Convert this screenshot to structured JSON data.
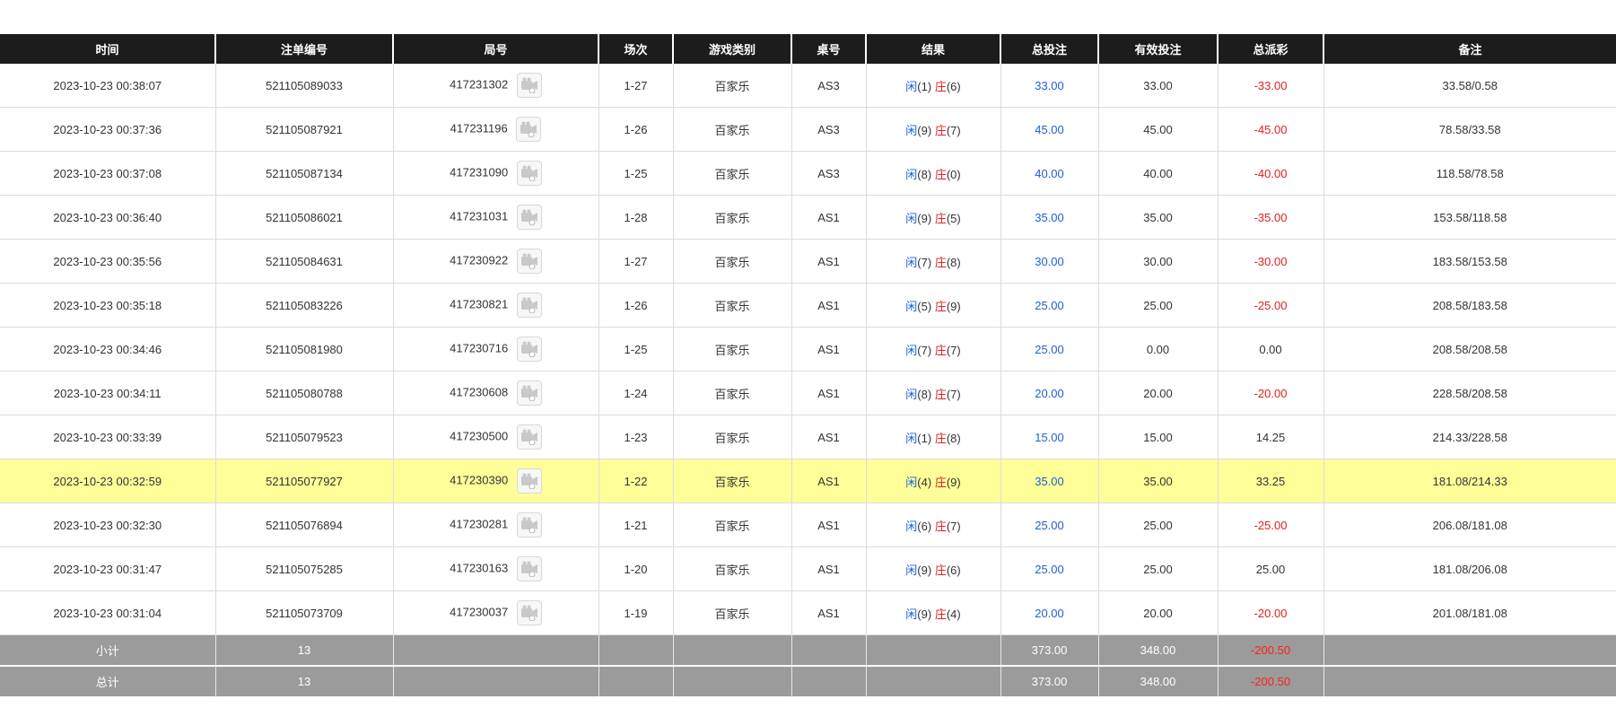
{
  "headers": [
    "时间",
    "注单编号",
    "局号",
    "场次",
    "游戏类别",
    "桌号",
    "结果",
    "总投注",
    "有效投注",
    "总派彩",
    "备注"
  ],
  "rows": [
    {
      "time": "2023-10-23 00:38:07",
      "bet_id": "521105089033",
      "round": "417231302",
      "session": "1-27",
      "game": "百家乐",
      "table": "AS3",
      "p_label": "闲",
      "p_score": "(1)",
      "b_label": "庄",
      "b_score": "(6)",
      "total_bet": "33.00",
      "valid_bet": "33.00",
      "payout": "-33.00",
      "payout_neg": true,
      "note": "33.58/0.58"
    },
    {
      "time": "2023-10-23 00:37:36",
      "bet_id": "521105087921",
      "round": "417231196",
      "session": "1-26",
      "game": "百家乐",
      "table": "AS3",
      "p_label": "闲",
      "p_score": "(9)",
      "b_label": "庄",
      "b_score": "(7)",
      "total_bet": "45.00",
      "valid_bet": "45.00",
      "payout": "-45.00",
      "payout_neg": true,
      "note": "78.58/33.58"
    },
    {
      "time": "2023-10-23 00:37:08",
      "bet_id": "521105087134",
      "round": "417231090",
      "session": "1-25",
      "game": "百家乐",
      "table": "AS3",
      "p_label": "闲",
      "p_score": "(8)",
      "b_label": "庄",
      "b_score": "(0)",
      "total_bet": "40.00",
      "valid_bet": "40.00",
      "payout": "-40.00",
      "payout_neg": true,
      "note": "118.58/78.58"
    },
    {
      "time": "2023-10-23 00:36:40",
      "bet_id": "521105086021",
      "round": "417231031",
      "session": "1-28",
      "game": "百家乐",
      "table": "AS1",
      "p_label": "闲",
      "p_score": "(9)",
      "b_label": "庄",
      "b_score": "(5)",
      "total_bet": "35.00",
      "valid_bet": "35.00",
      "payout": "-35.00",
      "payout_neg": true,
      "note": "153.58/118.58"
    },
    {
      "time": "2023-10-23 00:35:56",
      "bet_id": "521105084631",
      "round": "417230922",
      "session": "1-27",
      "game": "百家乐",
      "table": "AS1",
      "p_label": "闲",
      "p_score": "(7)",
      "b_label": "庄",
      "b_score": "(8)",
      "total_bet": "30.00",
      "valid_bet": "30.00",
      "payout": "-30.00",
      "payout_neg": true,
      "note": "183.58/153.58"
    },
    {
      "time": "2023-10-23 00:35:18",
      "bet_id": "521105083226",
      "round": "417230821",
      "session": "1-26",
      "game": "百家乐",
      "table": "AS1",
      "p_label": "闲",
      "p_score": "(5)",
      "b_label": "庄",
      "b_score": "(9)",
      "total_bet": "25.00",
      "valid_bet": "25.00",
      "payout": "-25.00",
      "payout_neg": true,
      "note": "208.58/183.58"
    },
    {
      "time": "2023-10-23 00:34:46",
      "bet_id": "521105081980",
      "round": "417230716",
      "session": "1-25",
      "game": "百家乐",
      "table": "AS1",
      "p_label": "闲",
      "p_score": "(7)",
      "b_label": "庄",
      "b_score": "(7)",
      "total_bet": "25.00",
      "valid_bet": "0.00",
      "payout": "0.00",
      "payout_neg": false,
      "note": "208.58/208.58"
    },
    {
      "time": "2023-10-23 00:34:11",
      "bet_id": "521105080788",
      "round": "417230608",
      "session": "1-24",
      "game": "百家乐",
      "table": "AS1",
      "p_label": "闲",
      "p_score": "(8)",
      "b_label": "庄",
      "b_score": "(7)",
      "total_bet": "20.00",
      "valid_bet": "20.00",
      "payout": "-20.00",
      "payout_neg": true,
      "note": "228.58/208.58"
    },
    {
      "time": "2023-10-23 00:33:39",
      "bet_id": "521105079523",
      "round": "417230500",
      "session": "1-23",
      "game": "百家乐",
      "table": "AS1",
      "p_label": "闲",
      "p_score": "(1)",
      "b_label": "庄",
      "b_score": "(8)",
      "total_bet": "15.00",
      "valid_bet": "15.00",
      "payout": "14.25",
      "payout_neg": false,
      "note": "214.33/228.58"
    },
    {
      "time": "2023-10-23 00:32:59",
      "bet_id": "521105077927",
      "round": "417230390",
      "session": "1-22",
      "game": "百家乐",
      "table": "AS1",
      "p_label": "闲",
      "p_score": "(4)",
      "b_label": "庄",
      "b_score": "(9)",
      "total_bet": "35.00",
      "valid_bet": "35.00",
      "payout": "33.25",
      "payout_neg": false,
      "note": "181.08/214.33",
      "highlight": true
    },
    {
      "time": "2023-10-23 00:32:30",
      "bet_id": "521105076894",
      "round": "417230281",
      "session": "1-21",
      "game": "百家乐",
      "table": "AS1",
      "p_label": "闲",
      "p_score": "(6)",
      "b_label": "庄",
      "b_score": "(7)",
      "total_bet": "25.00",
      "valid_bet": "25.00",
      "payout": "-25.00",
      "payout_neg": true,
      "note": "206.08/181.08"
    },
    {
      "time": "2023-10-23 00:31:47",
      "bet_id": "521105075285",
      "round": "417230163",
      "session": "1-20",
      "game": "百家乐",
      "table": "AS1",
      "p_label": "闲",
      "p_score": "(9)",
      "b_label": "庄",
      "b_score": "(6)",
      "total_bet": "25.00",
      "valid_bet": "25.00",
      "payout": "25.00",
      "payout_neg": false,
      "note": "181.08/206.08"
    },
    {
      "time": "2023-10-23 00:31:04",
      "bet_id": "521105073709",
      "round": "417230037",
      "session": "1-19",
      "game": "百家乐",
      "table": "AS1",
      "p_label": "闲",
      "p_score": "(9)",
      "b_label": "庄",
      "b_score": "(4)",
      "total_bet": "20.00",
      "valid_bet": "20.00",
      "payout": "-20.00",
      "payout_neg": true,
      "note": "201.08/181.08"
    }
  ],
  "subtotal": {
    "label": "小计",
    "count": "13",
    "total_bet": "373.00",
    "valid_bet": "348.00",
    "payout": "-200.50"
  },
  "grand_total": {
    "label": "总计",
    "count": "13",
    "total_bet": "373.00",
    "valid_bet": "348.00",
    "payout": "-200.50"
  },
  "icons": {
    "replay": "video-replay-icon"
  },
  "colors": {
    "header_bg": "#1c1c1c",
    "highlight_row": "#ffff99",
    "summary_bg": "#9b9b9b",
    "player_blue": "#1f5fd6",
    "banker_red": "#e02020"
  }
}
